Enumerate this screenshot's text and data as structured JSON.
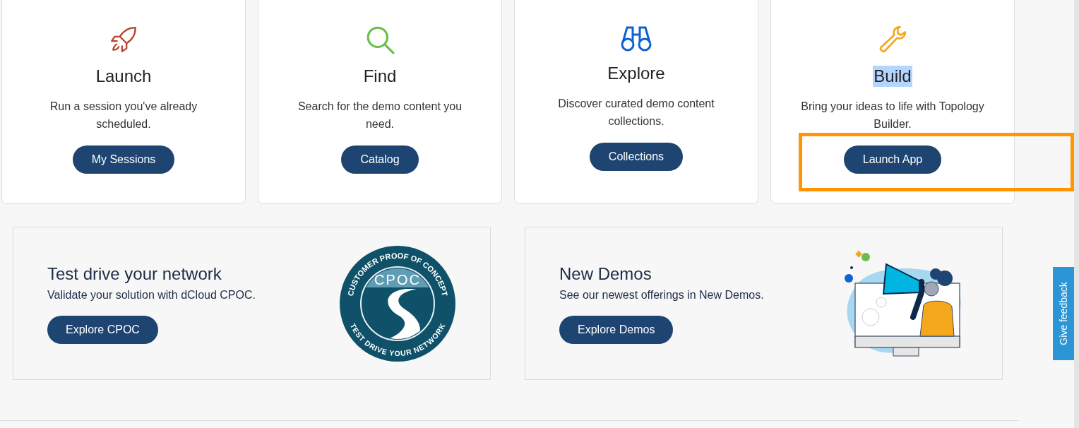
{
  "cards": [
    {
      "title": "Launch",
      "title_selected": false,
      "description": "Run a session you've already scheduled.",
      "button": "My Sessions",
      "annotated": false
    },
    {
      "title": "Find",
      "title_selected": false,
      "description": "Search for the demo content you need.",
      "button": "Catalog",
      "annotated": false
    },
    {
      "title": "Explore",
      "title_selected": false,
      "description": "Discover curated demo content collections.",
      "button": "Collections",
      "annotated": false
    },
    {
      "title": "Build",
      "title_selected": true,
      "description": "Bring your ideas to life with Topology Builder.",
      "button": "Launch App",
      "annotated": true
    }
  ],
  "promos": [
    {
      "kind": "badge",
      "title": "Test drive your network",
      "description": "Validate your solution with dCloud CPOC.",
      "button": "Explore CPOC",
      "badge": {
        "top_arc": "CUSTOMER PROOF OF CONCEPT",
        "center": "CPOC",
        "bottom_arc": "TEST DRIVE YOUR NETWORK"
      }
    },
    {
      "kind": "illustration",
      "title": "New Demos",
      "description": "See our newest offerings in New Demos.",
      "button": "Explore Demos"
    }
  ],
  "feedback_tab": "Give feedback"
}
